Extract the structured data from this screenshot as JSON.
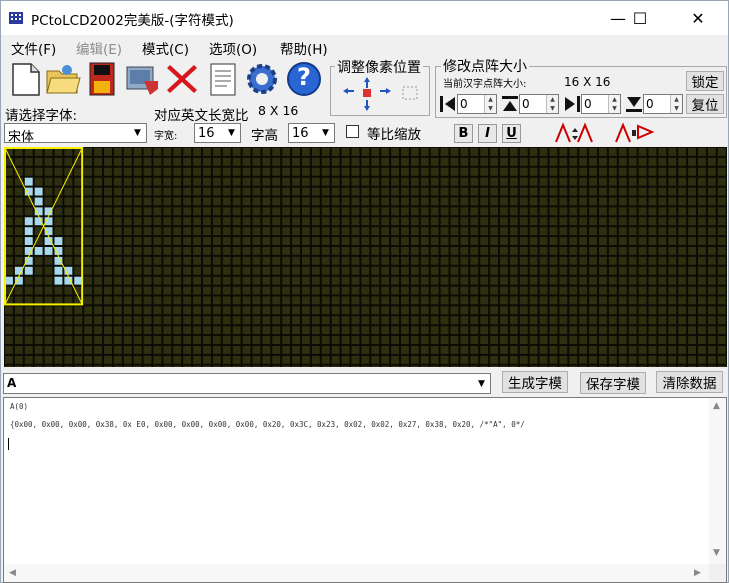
{
  "window": {
    "title": "PCtoLCD2002完美版-(字符模式)",
    "controls": {
      "minimize": "—",
      "maximize": "☐",
      "close": "✕"
    }
  },
  "menu": [
    {
      "label": "文件(F)",
      "enabled": true
    },
    {
      "label": "编辑(E)",
      "enabled": false
    },
    {
      "label": "模式(C)",
      "enabled": true
    },
    {
      "label": "选项(O)",
      "enabled": true
    },
    {
      "label": "帮助(H)",
      "enabled": true
    }
  ],
  "toolbar": {
    "icons": [
      "new-file-icon",
      "open-folder-icon",
      "save-disk-icon",
      "import-image-icon",
      "delete-x-icon",
      "notepad-icon",
      "settings-gear-icon",
      "help-icon"
    ],
    "help_glyph": "?"
  },
  "pixel_adjust": {
    "title": "调整像素位置"
  },
  "dot_matrix": {
    "title": "修改点阵大小",
    "current_label": "当前汉字点阵大小:",
    "current_value": "16 X 16",
    "lock_button": "锁定",
    "reset_button": "复位",
    "spinners": [
      "0",
      "0",
      "0",
      "0"
    ]
  },
  "font": {
    "select_label": "请选择字体:",
    "selected": "宋体",
    "ratio_label": "对应英文长宽比",
    "ratio_value": "8 X 16",
    "width_label": "字宽:",
    "width_value": "16",
    "height_label": "字高",
    "height_value": "16",
    "proportional_label": "等比缩放",
    "proportional_checked": false,
    "bold": "B",
    "italic": "I",
    "underline": "U"
  },
  "input": {
    "value": "A",
    "generate_button": "生成字模",
    "save_button": "保存字模",
    "clear_button": "清除数据"
  },
  "output": {
    "lines": [
      "A(0)",
      "{0x00, 0x00, 0x00, 0x38, 0x E0, 0x00, 0x00, 0x00, 0x00, 0x20, 0x3C, 0x23, 0x02, 0x02, 0x27, 0x38, 0x20, /*\"A\", 0*/"
    ]
  },
  "colors": {
    "canvas_bg": "#2e2e10",
    "grid_line": "#0c0c04",
    "lit_pixel": "#a8d8ee",
    "frame": "#f5f000"
  },
  "glyph_pixels": [
    [
      2,
      3
    ],
    [
      2,
      4
    ],
    [
      3,
      4
    ],
    [
      3,
      5
    ],
    [
      3,
      6
    ],
    [
      4,
      6
    ],
    [
      4,
      7
    ],
    [
      3,
      7
    ],
    [
      2,
      7
    ],
    [
      2,
      8
    ],
    [
      2,
      9
    ],
    [
      2,
      10
    ],
    [
      2,
      11
    ],
    [
      2,
      12
    ],
    [
      4,
      8
    ],
    [
      4,
      9
    ],
    [
      5,
      9
    ],
    [
      5,
      10
    ],
    [
      4,
      10
    ],
    [
      3,
      10
    ],
    [
      5,
      11
    ],
    [
      5,
      12
    ],
    [
      6,
      12
    ],
    [
      6,
      13
    ],
    [
      5,
      13
    ],
    [
      7,
      13
    ],
    [
      1,
      13
    ],
    [
      0,
      13
    ],
    [
      1,
      12
    ]
  ]
}
